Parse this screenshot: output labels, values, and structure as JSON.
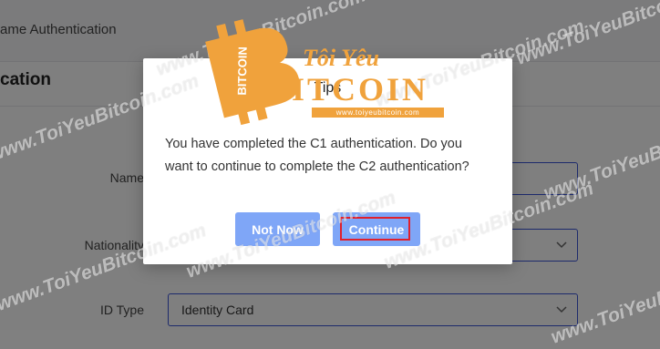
{
  "page": {
    "breadcrumb": "ame Authentication",
    "heading": "cation"
  },
  "form": {
    "name_label": "Name",
    "nationality_label": "Nationality",
    "id_type_label": "ID Type",
    "id_type_value": "Identity Card"
  },
  "dialog": {
    "title": "Tips",
    "message": "You have completed the C1 authentication. Do you want to continue to complete the C2 authentication?",
    "not_now_label": "Not Now",
    "continue_label": "Continue"
  },
  "watermark": {
    "text": "www.ToiYeuBitcoin.com",
    "logo_top": "Tôi Yêu",
    "logo_bottom": "ITCOIN",
    "logo_badge": "BITCOIN",
    "logo_url": "www.toiyeubitcoin.com"
  },
  "colors": {
    "accent_button": "#7fa6f7",
    "input_border": "#3b55d9",
    "highlight": "#e0202c",
    "logo_orange": "#f0a23c"
  }
}
